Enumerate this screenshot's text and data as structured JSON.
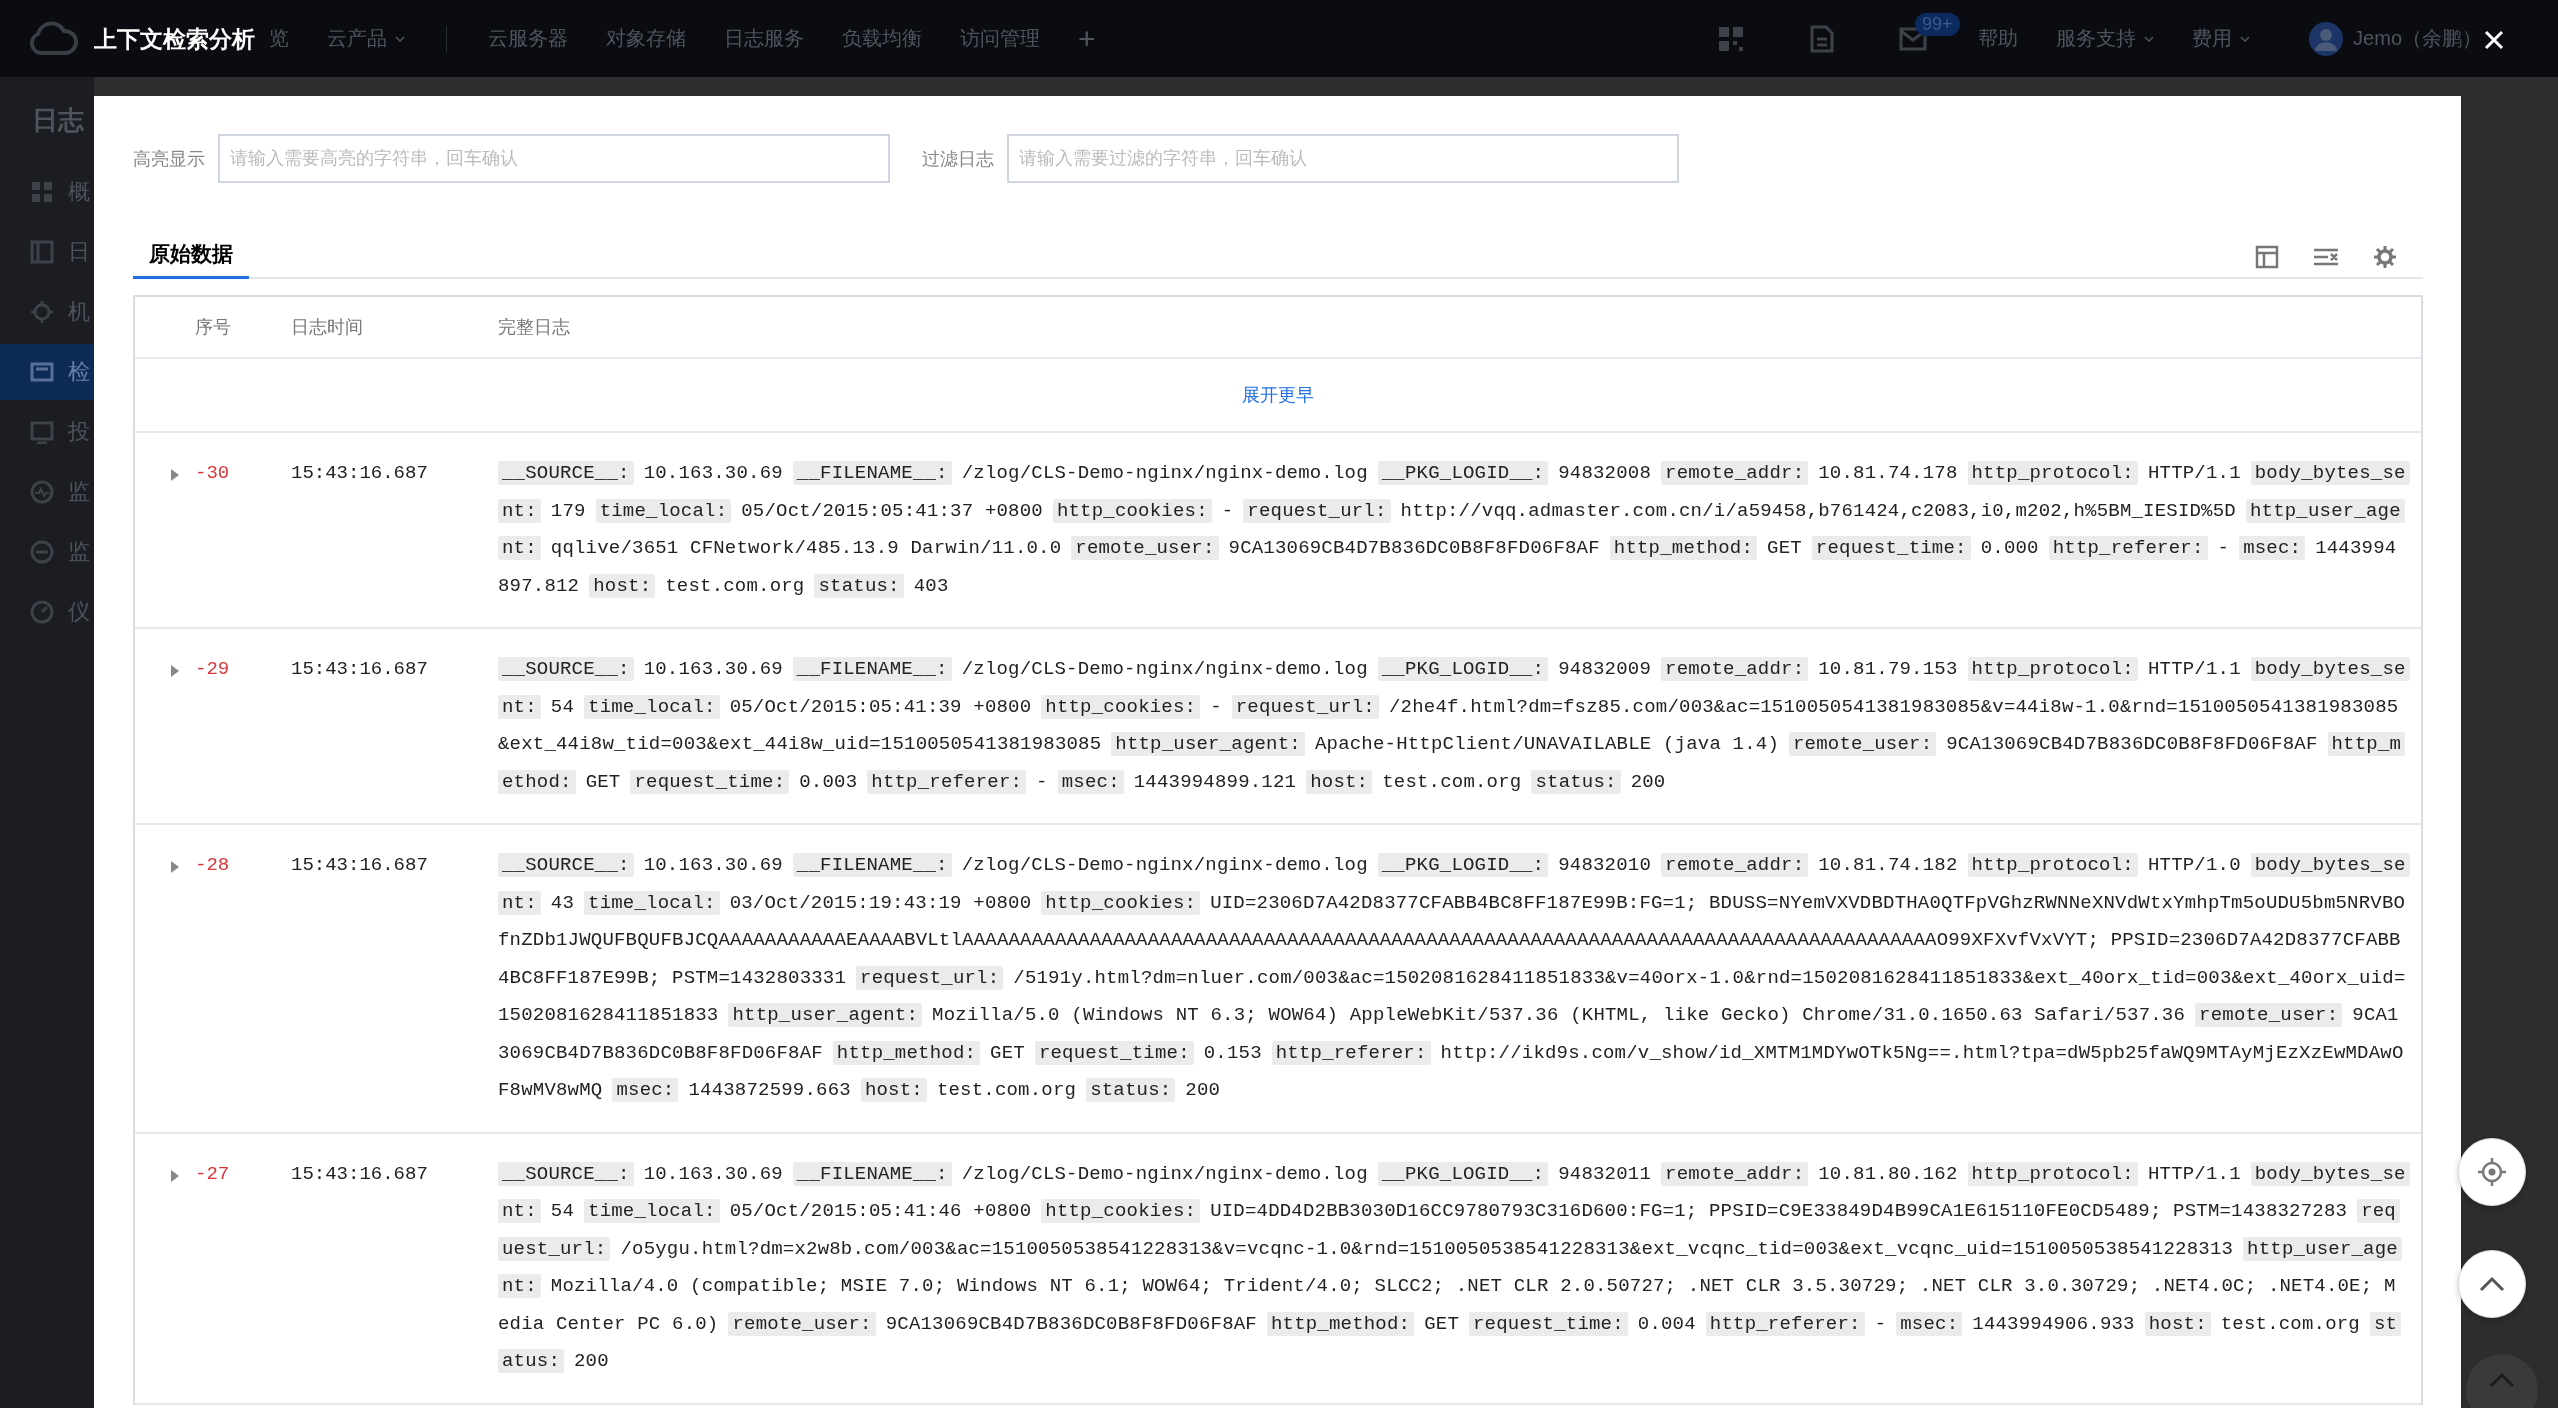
{
  "top_bar": {
    "nav_items": [
      {
        "label": "览",
        "dropdown": false
      },
      {
        "label": "云产品",
        "dropdown": true
      },
      {
        "label": "云服务器",
        "dropdown": false
      },
      {
        "label": "对象存储",
        "dropdown": false
      },
      {
        "label": "日志服务",
        "dropdown": false
      },
      {
        "label": "负载均衡",
        "dropdown": false
      },
      {
        "label": "访问管理",
        "dropdown": false
      },
      {
        "label": "+",
        "dropdown": false
      }
    ],
    "mail_badge": "99+",
    "links": [
      {
        "label": "帮助",
        "dropdown": false
      },
      {
        "label": "服务支持",
        "dropdown": true
      },
      {
        "label": "费用",
        "dropdown": true
      }
    ],
    "user": "Jemo（余鹏）"
  },
  "sidebar": {
    "title": "日志",
    "items": [
      {
        "label": "概",
        "selected": false
      },
      {
        "label": "日",
        "selected": false
      },
      {
        "label": "机",
        "selected": false
      },
      {
        "label": "检",
        "selected": true
      },
      {
        "label": "投",
        "selected": false
      },
      {
        "label": "监",
        "selected": false
      },
      {
        "label": "监",
        "selected": false
      },
      {
        "label": "仪",
        "selected": false
      }
    ]
  },
  "dialog": {
    "title": "上下文检索分析",
    "highlight_field": {
      "label": "高亮显示",
      "placeholder": "请输入需要高亮的字符串，回车确认"
    },
    "filter_field": {
      "label": "过滤日志",
      "placeholder": "请输入需要过滤的字符串，回车确认"
    },
    "tabs": [
      {
        "label": "原始数据",
        "selected": true
      }
    ],
    "table": {
      "columns": [
        "序号",
        "日志时间",
        "完整日志"
      ],
      "load_earlier": "展开更早",
      "rows": [
        {
          "index": "-30",
          "time": "15:43:16.687",
          "expanded": false,
          "fields": [
            {
              "key": "__SOURCE__:",
              "value": "10.163.30.69"
            },
            {
              "key": "__FILENAME__:",
              "value": "/zlog/CLS-Demo-nginx/nginx-demo.log"
            },
            {
              "key": "__PKG_LOGID__:",
              "value": "94832008"
            },
            {
              "key": "remote_addr:",
              "value": "10.81.74.178"
            },
            {
              "key": "http_protocol:",
              "value": "HTTP/1.1"
            },
            {
              "key": "body_bytes_sent:",
              "value": "179"
            },
            {
              "key": "time_local:",
              "value": "05/Oct/2015:05:41:37 +0800"
            },
            {
              "key": "http_cookies:",
              "value": "-"
            },
            {
              "key": "request_url:",
              "value": "http://vqq.admaster.com.cn/i/a59458,b761424,c2083,i0,m202,h%5BM_IESID%5D"
            },
            {
              "key": "http_user_agent:",
              "value": "qqlive/3651 CFNetwork/485.13.9 Darwin/11.0.0"
            },
            {
              "key": "remote_user:",
              "value": "9CA13069CB4D7B836DC0B8F8FD06F8AF"
            },
            {
              "key": "http_method:",
              "value": "GET"
            },
            {
              "key": "request_time:",
              "value": "0.000"
            },
            {
              "key": "http_referer:",
              "value": "-"
            },
            {
              "key": "msec:",
              "value": "1443994897.812"
            },
            {
              "key": "host:",
              "value": "test.com.org"
            },
            {
              "key": "status:",
              "value": "403"
            }
          ]
        },
        {
          "index": "-29",
          "time": "15:43:16.687",
          "expanded": false,
          "fields": [
            {
              "key": "__SOURCE__:",
              "value": "10.163.30.69"
            },
            {
              "key": "__FILENAME__:",
              "value": "/zlog/CLS-Demo-nginx/nginx-demo.log"
            },
            {
              "key": "__PKG_LOGID__:",
              "value": "94832009"
            },
            {
              "key": "remote_addr:",
              "value": "10.81.79.153"
            },
            {
              "key": "http_protocol:",
              "value": "HTTP/1.1"
            },
            {
              "key": "body_bytes_sent:",
              "value": "54"
            },
            {
              "key": "time_local:",
              "value": "05/Oct/2015:05:41:39 +0800"
            },
            {
              "key": "http_cookies:",
              "value": "-"
            },
            {
              "key": "request_url:",
              "value": "/2he4f.html?dm=fsz85.com/003&ac=1510050541381983085&v=44i8w-1.0&rnd=1510050541381983085&ext_44i8w_tid=003&ext_44i8w_uid=1510050541381983085"
            },
            {
              "key": "http_user_agent:",
              "value": "Apache-HttpClient/UNAVAILABLE (java 1.4)"
            },
            {
              "key": "remote_user:",
              "value": "9CA13069CB4D7B836DC0B8F8FD06F8AF"
            },
            {
              "key": "http_method:",
              "value": "GET"
            },
            {
              "key": "request_time:",
              "value": "0.003"
            },
            {
              "key": "http_referer:",
              "value": "-"
            },
            {
              "key": "msec:",
              "value": "1443994899.121"
            },
            {
              "key": "host:",
              "value": "test.com.org"
            },
            {
              "key": "status:",
              "value": "200"
            }
          ]
        },
        {
          "index": "-28",
          "time": "15:43:16.687",
          "expanded": false,
          "fields": [
            {
              "key": "__SOURCE__:",
              "value": "10.163.30.69"
            },
            {
              "key": "__FILENAME__:",
              "value": "/zlog/CLS-Demo-nginx/nginx-demo.log"
            },
            {
              "key": "__PKG_LOGID__:",
              "value": "94832010"
            },
            {
              "key": "remote_addr:",
              "value": "10.81.74.182"
            },
            {
              "key": "http_protocol:",
              "value": "HTTP/1.0"
            },
            {
              "key": "body_bytes_sent:",
              "value": "43"
            },
            {
              "key": "time_local:",
              "value": "03/Oct/2015:19:43:19 +0800"
            },
            {
              "key": "http_cookies:",
              "value": "UID=2306D7A42D8377CFABB4BC8FF187E99B:FG=1; BDUSS=NYemVXVDBDTHA0QTFpVGhzRWNNeXNVdWtxYmhpTm5oUDU5bm5NRVBOfnZDb1JWQUFBQUFBJCQAAAAAAAAAAAEAAAABVLtlAAAAAAAAAAAAAAAAAAAAAAAAAAAAAAAAAAAAAAAAAAAAAAAAAAAAAAAAAAAAAAAAAAAAAAAAAAAAAAAAAAAAO99XFXvfVxVYT; PPSID=2306D7A42D8377CFABB4BC8FF187E99B; PSTM=1432803331"
            },
            {
              "key": "request_url:",
              "value": "/5191y.html?dm=nluer.com/003&ac=1502081628411851833&v=40orx-1.0&rnd=1502081628411851833&ext_40orx_tid=003&ext_40orx_uid=1502081628411851833"
            },
            {
              "key": "http_user_agent:",
              "value": "Mozilla/5.0 (Windows NT 6.3; WOW64) AppleWebKit/537.36 (KHTML, like Gecko) Chrome/31.0.1650.63 Safari/537.36"
            },
            {
              "key": "remote_user:",
              "value": "9CA13069CB4D7B836DC0B8F8FD06F8AF"
            },
            {
              "key": "http_method:",
              "value": "GET"
            },
            {
              "key": "request_time:",
              "value": "0.153"
            },
            {
              "key": "http_referer:",
              "value": "http://ikd9s.com/v_show/id_XMTM1MDYwOTk5Ng==.html?tpa=dW5pb25faWQ9MTAyMjEzXzEwMDAwOF8wMV8wMQ"
            },
            {
              "key": "msec:",
              "value": "1443872599.663"
            },
            {
              "key": "host:",
              "value": "test.com.org"
            },
            {
              "key": "status:",
              "value": "200"
            }
          ]
        },
        {
          "index": "-27",
          "time": "15:43:16.687",
          "expanded": false,
          "fields": [
            {
              "key": "__SOURCE__:",
              "value": "10.163.30.69"
            },
            {
              "key": "__FILENAME__:",
              "value": "/zlog/CLS-Demo-nginx/nginx-demo.log"
            },
            {
              "key": "__PKG_LOGID__:",
              "value": "94832011"
            },
            {
              "key": "remote_addr:",
              "value": "10.81.80.162"
            },
            {
              "key": "http_protocol:",
              "value": "HTTP/1.1"
            },
            {
              "key": "body_bytes_sent:",
              "value": "54"
            },
            {
              "key": "time_local:",
              "value": "05/Oct/2015:05:41:46 +0800"
            },
            {
              "key": "http_cookies:",
              "value": "UID=4DD4D2BB3030D16CC9780793C316D600:FG=1; PPSID=C9E33849D4B99CA1E615110FE0CD5489; PSTM=1438327283"
            },
            {
              "key": "request_url:",
              "value": "/o5ygu.html?dm=x2w8b.com/003&ac=1510050538541228313&v=vcqnc-1.0&rnd=1510050538541228313&ext_vcqnc_tid=003&ext_vcqnc_uid=1510050538541228313"
            },
            {
              "key": "http_user_agent:",
              "value": "Mozilla/4.0 (compatible; MSIE 7.0; Windows NT 6.1; WOW64; Trident/4.0; SLCC2; .NET CLR 2.0.50727; .NET CLR 3.5.30729; .NET CLR 3.0.30729; .NET4.0C; .NET4.0E; Media Center PC 6.0)"
            },
            {
              "key": "remote_user:",
              "value": "9CA13069CB4D7B836DC0B8F8FD06F8AF"
            },
            {
              "key": "http_method:",
              "value": "GET"
            },
            {
              "key": "request_time:",
              "value": "0.004"
            },
            {
              "key": "http_referer:",
              "value": "-"
            },
            {
              "key": "msec:",
              "value": "1443994906.933"
            },
            {
              "key": "host:",
              "value": "test.com.org"
            },
            {
              "key": "status:",
              "value": "200"
            }
          ]
        }
      ]
    }
  }
}
